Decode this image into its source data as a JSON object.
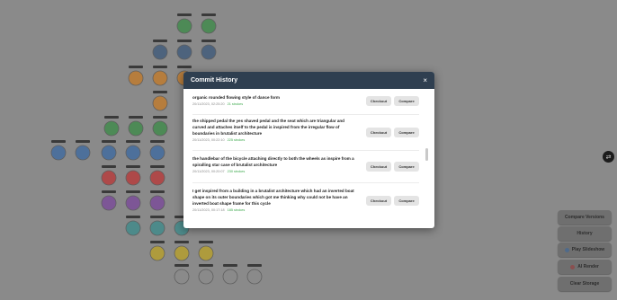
{
  "colors": {
    "backdrop": "#8a8a8a",
    "header": "#2f3f50",
    "strokes_text": "#3aa84a"
  },
  "side_panel": {
    "compare_versions": "Compare Versions",
    "history": "History",
    "play_slideshow": "Play Slideshow",
    "ai_render": "AI Render",
    "clear_storage": "Clear Storage"
  },
  "modal": {
    "title": "Commit History",
    "close_glyph": "×",
    "checkout_label": "Checkout",
    "compare_label": "Compare",
    "commits": [
      {
        "message": "organic rounded flowing style of dance form",
        "timestamp": "20/11/2023, 02:25:20",
        "strokes": "21 strokes"
      },
      {
        "message": "the shipped pedal the yes shaved pedal and the seat which are triangular and curved and attaches itself to the pedal is inspired from the irregular flow of boundaries in brutalist architecture",
        "timestamp": "20/11/2023, 00:22:10",
        "strokes": "225 strokes"
      },
      {
        "message": "the handlebar of the bicycle attaching directly to both the wheels as inspire from a spiralling star case of brutalist architecture",
        "timestamp": "20/11/2023, 00:20:07",
        "strokes": "230 strokes"
      },
      {
        "message": "I get inspired from a building in a brutalist architecture which had an inverted boat shape on its outer boundaries which got me thinking why could not be have an inverted boat shape frame for this cycle",
        "timestamp": "20/11/2023, 00:17:18",
        "strokes": "185 strokes"
      }
    ]
  }
}
